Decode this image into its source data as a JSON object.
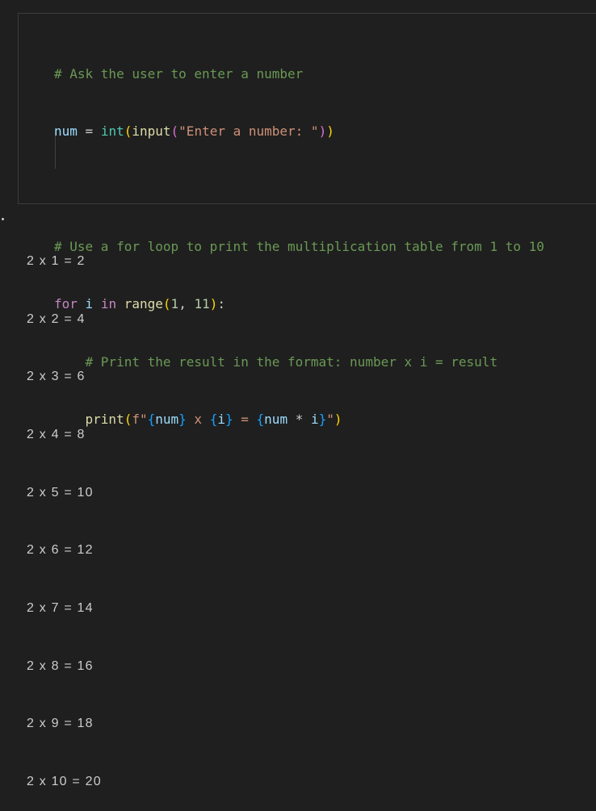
{
  "cell": {
    "code": {
      "line1_comment": "# Ask the user to enter a number",
      "line2": {
        "var": "num",
        "eq": " = ",
        "int_fn": "int",
        "paren_open1": "(",
        "input_fn": "input",
        "paren_open2": "(",
        "prompt": "\"Enter a number: \"",
        "paren_close2": ")",
        "paren_close1": ")"
      },
      "line4_comment": "# Use a for loop to print the multiplication table from 1 to 10",
      "line5": {
        "kw_for": "for",
        "sp1": " ",
        "var_i": "i",
        "sp2": " ",
        "kw_in": "in",
        "sp3": " ",
        "range_fn": "range",
        "paren_open": "(",
        "n1": "1",
        "comma": ", ",
        "n2": "11",
        "paren_close": ")",
        "colon": ":"
      },
      "line6_comment": "# Print the result in the format: number x i = result",
      "line7": {
        "print_fn": "print",
        "paren_open": "(",
        "f_prefix": "f\"",
        "b1_open": "{",
        "b1_var": "num",
        "b1_close": "}",
        "mid1": " x ",
        "b2_open": "{",
        "b2_var": "i",
        "b2_close": "}",
        "mid2": " = ",
        "b3_open": "{",
        "b3_var1": "num",
        "b3_op": " * ",
        "b3_var2": "i",
        "b3_close": "}",
        "f_end": "\"",
        "paren_close": ")"
      }
    }
  },
  "output": {
    "lines": [
      "2 x 1 = 2",
      "2 x 2 = 4",
      "2 x 3 = 6",
      "2 x 4 = 8",
      "2 x 5 = 10",
      "2 x 6 = 12",
      "2 x 7 = 14",
      "2 x 8 = 16",
      "2 x 9 = 18",
      "2 x 10 = 20"
    ]
  },
  "colors": {
    "background": "#1f1f1f",
    "comment": "#6a9955",
    "variable": "#9cdcfe",
    "function": "#dcdcaa",
    "string": "#ce9178",
    "number": "#b5cea8",
    "keyword": "#c586c0",
    "bracket_level1": "#ffd700",
    "bracket_level2": "#da70d6",
    "bracket_level3": "#179fff"
  }
}
